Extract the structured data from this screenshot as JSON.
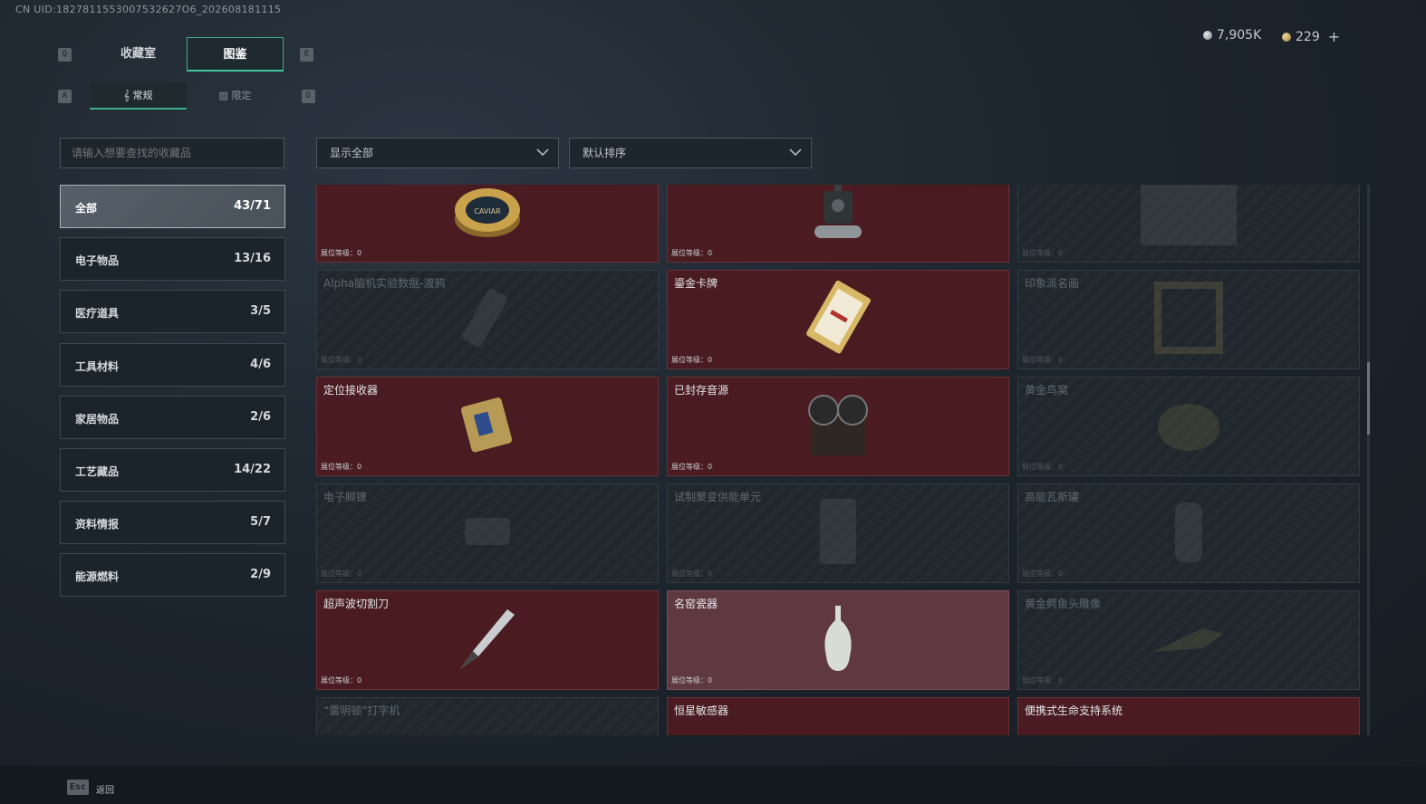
{
  "uid": "CN UID:1827811553007532627O6_202608181115",
  "keys": {
    "prev_main": "Q",
    "next_main": "E",
    "prev_sub": "A",
    "next_sub": "D"
  },
  "main_tabs": [
    {
      "label": "收藏室"
    },
    {
      "label": "图鉴"
    }
  ],
  "sub_tabs": [
    {
      "label": "常规"
    },
    {
      "label": "限定"
    }
  ],
  "currency": {
    "silver": "7,905K",
    "gold": "229",
    "add": "+"
  },
  "search": {
    "placeholder": "请输入想要查找的收藏品"
  },
  "filters": {
    "show": "显示全部",
    "sort": "默认排序"
  },
  "categories": [
    {
      "label": "全部",
      "count": "43/71"
    },
    {
      "label": "电子物品",
      "count": "13/16"
    },
    {
      "label": "医疗道具",
      "count": "3/5"
    },
    {
      "label": "工具材料",
      "count": "4/6"
    },
    {
      "label": "家居物品",
      "count": "2/6"
    },
    {
      "label": "工艺藏品",
      "count": "14/22"
    },
    {
      "label": "资料情报",
      "count": "5/7"
    },
    {
      "label": "能源燃料",
      "count": "2/9"
    }
  ],
  "level_label": "展位等级：0",
  "cards": [
    {
      "name": "",
      "icon": "caviar-tin-icon",
      "owned": true
    },
    {
      "name": "",
      "icon": "robot-device-icon",
      "owned": true
    },
    {
      "name": "",
      "icon": "painting-icon",
      "owned": false
    },
    {
      "name": "Alpha脑机实验数据-渡鸦",
      "icon": "data-device-icon",
      "owned": false
    },
    {
      "name": "鎏金卡牌",
      "icon": "gold-card-icon",
      "owned": true
    },
    {
      "name": "印象派名画",
      "icon": "framed-painting-icon",
      "owned": false
    },
    {
      "name": "定位接收器",
      "icon": "receiver-icon",
      "owned": true
    },
    {
      "name": "已封存音源",
      "icon": "reel-recorder-icon",
      "owned": true
    },
    {
      "name": "黄金鸟窝",
      "icon": "bird-nest-icon",
      "owned": false
    },
    {
      "name": "电子脚镣",
      "icon": "ankle-monitor-icon",
      "owned": false
    },
    {
      "name": "试制聚变供能单元",
      "icon": "fusion-unit-icon",
      "owned": false
    },
    {
      "name": "高能瓦斯罐",
      "icon": "gas-canister-icon",
      "owned": false
    },
    {
      "name": "超声波切割刀",
      "icon": "ultrasonic-knife-icon",
      "owned": true
    },
    {
      "name": "名窑瓷器",
      "icon": "porcelain-vase-icon",
      "owned": true
    },
    {
      "name": "黄金鳄鱼头雕像",
      "icon": "croc-statue-icon",
      "owned": false
    },
    {
      "name": "“雷明顿”打字机",
      "icon": "typewriter-icon",
      "owned": false
    },
    {
      "name": "恒星敏感器",
      "icon": "star-sensor-icon",
      "owned": true
    },
    {
      "name": "便携式生命支持系统",
      "icon": "life-support-icon",
      "owned": true
    }
  ],
  "footer": {
    "esc": "Esc",
    "back": "返回"
  }
}
